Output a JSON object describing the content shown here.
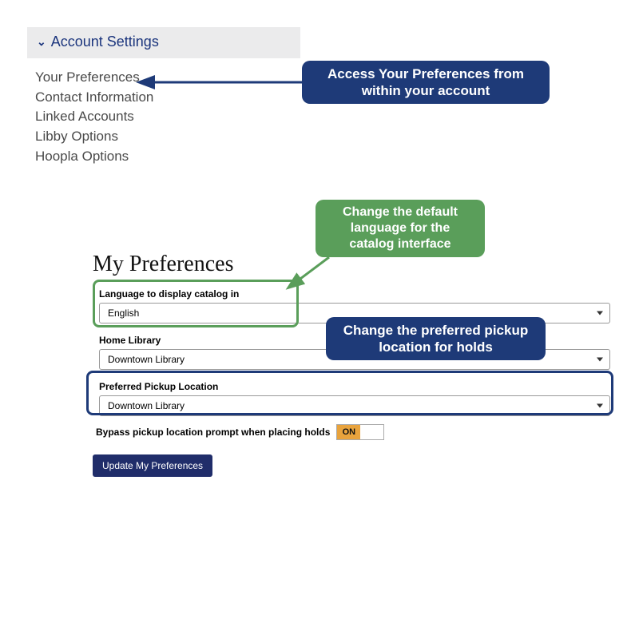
{
  "sidebar": {
    "header": "Account Settings",
    "items": [
      "Your Preferences",
      "Contact Information",
      "Linked Accounts",
      "Libby Options",
      "Hoopla Options"
    ]
  },
  "callouts": {
    "access": "Access Your Preferences from within your account",
    "language": "Change the default language for the catalog interface",
    "pickup": "Change the preferred pickup location for holds"
  },
  "prefs": {
    "title": "My Preferences",
    "language_label": "Language to display catalog in",
    "language_value": "English",
    "home_label": "Home Library",
    "home_value": "Downtown Library",
    "pickup_label": "Preferred Pickup Location",
    "pickup_value": "Downtown Library",
    "bypass_label": "Bypass pickup location prompt when placing holds",
    "toggle_value": "ON",
    "update_button": "Update My Preferences"
  },
  "colors": {
    "navy": "#1e3a78",
    "green": "#5a9e5a",
    "toggle_on": "#e8a33d"
  }
}
